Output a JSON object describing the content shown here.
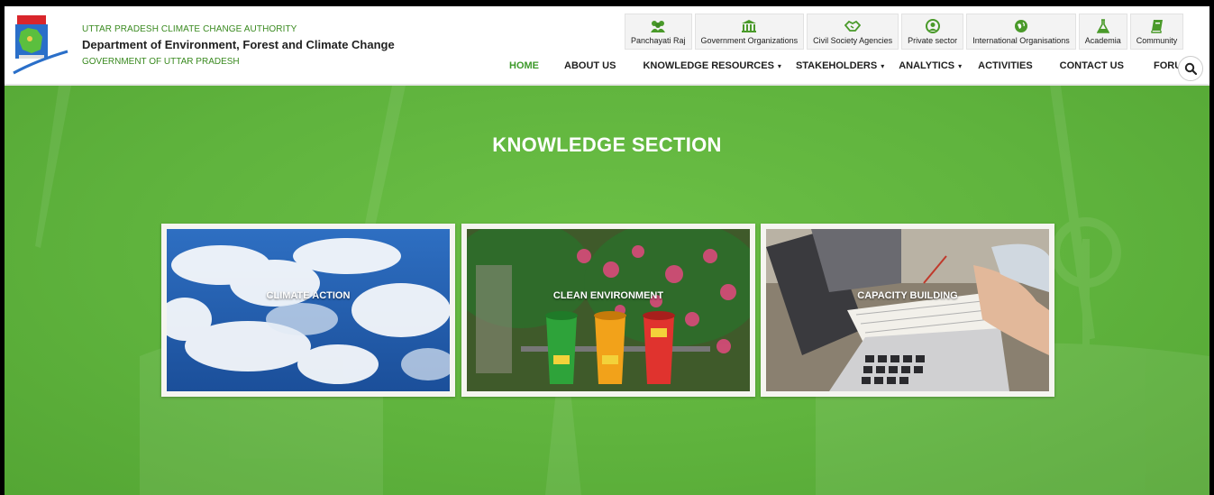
{
  "header": {
    "org_line1": "UTTAR PRADESH CLIMATE CHANGE AUTHORITY",
    "org_line2": "Department of Environment, Forest and Climate Change",
    "org_line3": "GOVERNMENT OF UTTAR PRADESH",
    "logo_icon": "up-government-emblem-logo"
  },
  "stakeholders": [
    {
      "label": "Panchayati Raj",
      "icon": "people-group-icon"
    },
    {
      "label": "Government Organizations",
      "icon": "government-building-icon"
    },
    {
      "label": "Civil Society Agencies",
      "icon": "handshake-icon"
    },
    {
      "label": "Private sector",
      "icon": "user-circle-icon"
    },
    {
      "label": "International Organisations",
      "icon": "globe-icon"
    },
    {
      "label": "Academia",
      "icon": "flask-icon"
    },
    {
      "label": "Community",
      "icon": "book-icon"
    }
  ],
  "nav": {
    "home": "HOME",
    "about": "ABOUT US",
    "knowledge": "KNOWLEDGE RESOURCES",
    "stakeholders": "STAKEHOLDERS",
    "analytics": "ANALYTICS",
    "activities": "ACTIVITIES",
    "contact": "CONTACT US",
    "forum": "FORUM",
    "active": "HOME"
  },
  "hero": {
    "title": "KNOWLEDGE SECTION",
    "cards": [
      {
        "label": "CLIMATE ACTION"
      },
      {
        "label": "CLEAN ENVIRONMENT"
      },
      {
        "label": "CAPACITY BUILDING"
      }
    ]
  },
  "colors": {
    "brand_green": "#3d9a2a",
    "hero_green": "#5fb13f",
    "stake_icon_green": "#4a9a2a"
  }
}
